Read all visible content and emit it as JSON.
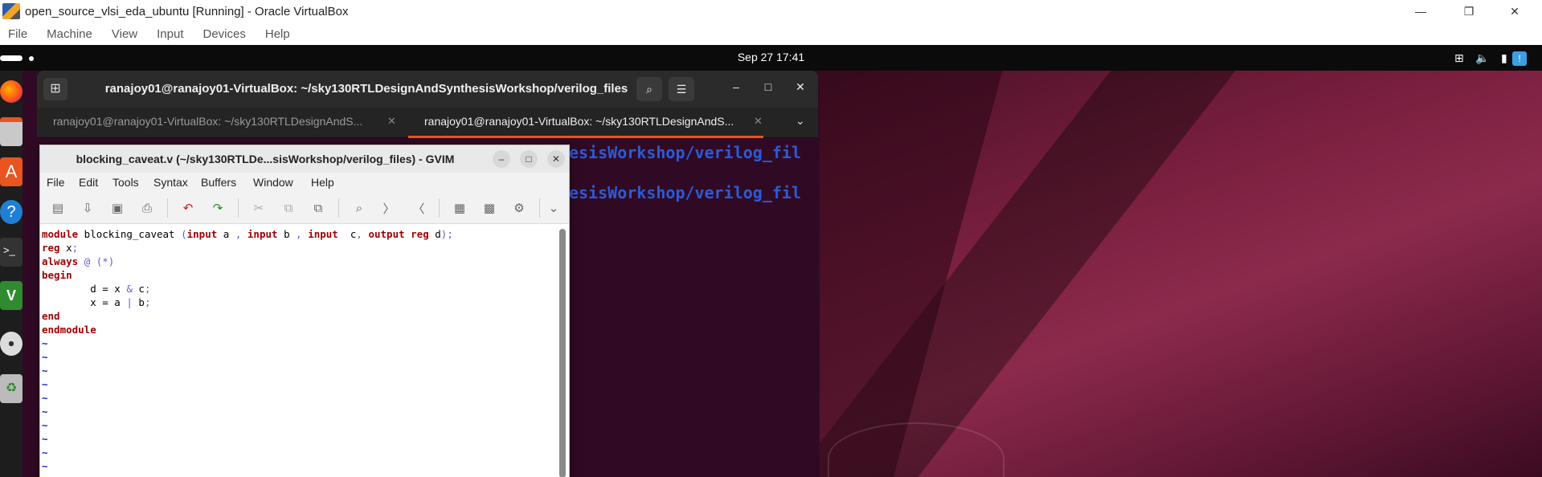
{
  "vbox": {
    "title": "open_source_vlsi_eda_ubuntu [Running] - Oracle VirtualBox",
    "menu": [
      "File",
      "Machine",
      "View",
      "Input",
      "Devices",
      "Help"
    ],
    "controls": {
      "minimize": "—",
      "restore": "❐",
      "close": "✕"
    }
  },
  "guest": {
    "clock": "Sep 27  17:41",
    "tray": [
      "network-icon",
      "volume-icon",
      "battery-icon"
    ]
  },
  "terminal": {
    "title": "ranajoy01@ranajoy01-VirtualBox: ~/sky130RTLDesignAndSynthesisWorkshop/verilog_files",
    "tabs": [
      {
        "label": "ranajoy01@ranajoy01-VirtualBox: ~/sky130RTLDesignAndS...",
        "active": false
      },
      {
        "label": "ranajoy01@ranajoy01-VirtualBox: ~/sky130RTLDesignAndS...",
        "active": true
      }
    ],
    "visible_lines": [
      "esisWorkshop/verilog_fil",
      "esisWorkshop/verilog_fil"
    ]
  },
  "gvim": {
    "title": "blocking_caveat.v (~/sky130RTLDe...sisWorkshop/verilog_files) - GVIM",
    "menu": [
      "File",
      "Edit",
      "Tools",
      "Syntax",
      "Buffers",
      "Window",
      "Help"
    ],
    "toolbar": [
      "open-icon",
      "save-down-icon",
      "save-icon",
      "print-icon",
      "undo-icon",
      "redo-icon",
      "cut-icon",
      "copy-icon",
      "paste-icon",
      "find-replace-icon",
      "find-next-icon",
      "find-prev-icon",
      "load-session-icon",
      "save-session-icon",
      "run-script-icon",
      "more-icon"
    ],
    "code": [
      [
        [
          "kw",
          "module"
        ],
        [
          "pl",
          " blocking_caveat "
        ],
        [
          "op",
          "("
        ],
        [
          "kw",
          "input"
        ],
        [
          "pl",
          " a "
        ],
        [
          "op",
          ","
        ],
        [
          "pl",
          " "
        ],
        [
          "kw",
          "input"
        ],
        [
          "pl",
          " b "
        ],
        [
          "op",
          ","
        ],
        [
          "pl",
          " "
        ],
        [
          "kw",
          "input"
        ],
        [
          "pl",
          "  c"
        ],
        [
          "op",
          ","
        ],
        [
          "pl",
          " "
        ],
        [
          "kw",
          "output"
        ],
        [
          "pl",
          " "
        ],
        [
          "kw",
          "reg"
        ],
        [
          "pl",
          " d"
        ],
        [
          "op",
          ");"
        ]
      ],
      [
        [
          "kw",
          "reg"
        ],
        [
          "pl",
          " x"
        ],
        [
          "op",
          ";"
        ]
      ],
      [
        [
          "kw",
          "always"
        ],
        [
          "pl",
          " "
        ],
        [
          "op",
          "@ (*)"
        ]
      ],
      [
        [
          "kw",
          "begin"
        ]
      ],
      [
        [
          "pl",
          "        d = x "
        ],
        [
          "op",
          "&"
        ],
        [
          "pl",
          " c"
        ],
        [
          "op",
          ";"
        ]
      ],
      [
        [
          "pl",
          "        x = a "
        ],
        [
          "op",
          "|"
        ],
        [
          "pl",
          " b"
        ],
        [
          "op",
          ";"
        ]
      ],
      [
        [
          "kw",
          "end"
        ]
      ],
      [
        [
          "kw",
          "endmodule"
        ]
      ]
    ],
    "tilde_lines": 10
  }
}
